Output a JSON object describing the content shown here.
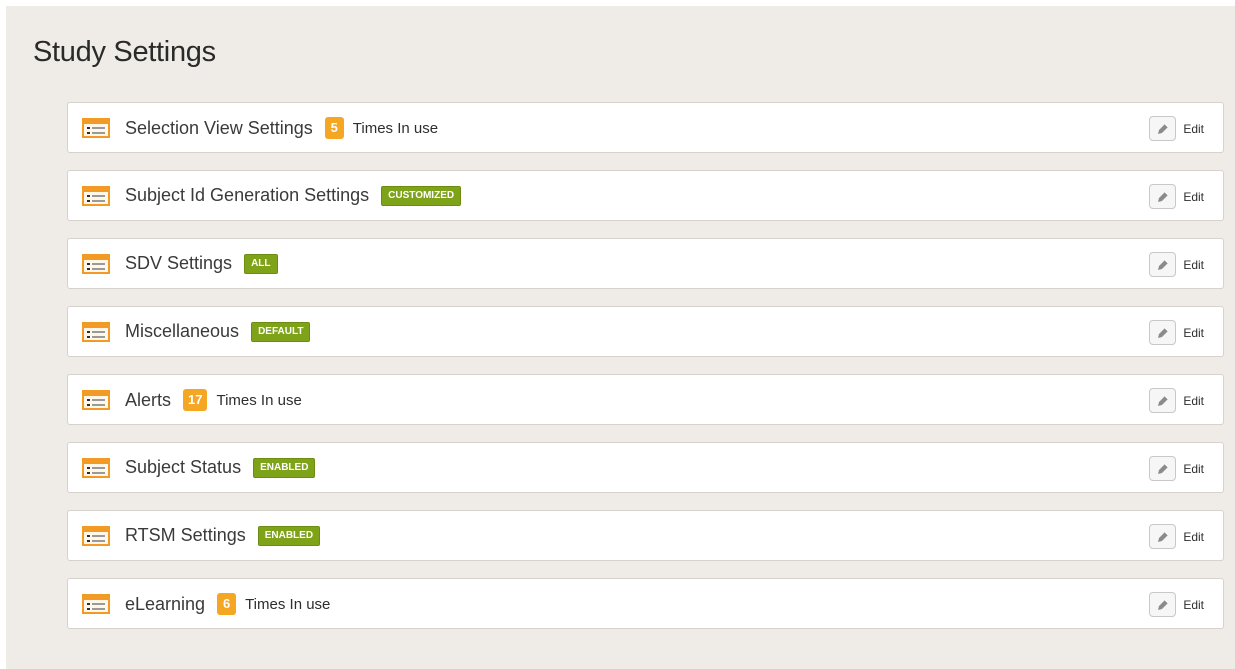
{
  "page": {
    "title": "Study Settings"
  },
  "settings": [
    {
      "label": "Selection View Settings",
      "badge_type": "count",
      "badge_text": "5",
      "usage_text": "Times In use",
      "edit_label": "Edit"
    },
    {
      "label": "Subject Id Generation Settings",
      "badge_type": "status",
      "badge_text": "CUSTOMIZED",
      "usage_text": "",
      "edit_label": "Edit"
    },
    {
      "label": "SDV Settings",
      "badge_type": "status",
      "badge_text": "ALL",
      "usage_text": "",
      "edit_label": "Edit"
    },
    {
      "label": "Miscellaneous",
      "badge_type": "status",
      "badge_text": "DEFAULT",
      "usage_text": "",
      "edit_label": "Edit"
    },
    {
      "label": "Alerts",
      "badge_type": "count",
      "badge_text": "17",
      "usage_text": "Times In use",
      "edit_label": "Edit"
    },
    {
      "label": "Subject Status",
      "badge_type": "status",
      "badge_text": "ENABLED",
      "usage_text": "",
      "edit_label": "Edit"
    },
    {
      "label": "RTSM Settings",
      "badge_type": "status",
      "badge_text": "ENABLED",
      "usage_text": "",
      "edit_label": "Edit"
    },
    {
      "label": "eLearning",
      "badge_type": "count",
      "badge_text": "6",
      "usage_text": "Times In use",
      "edit_label": "Edit"
    }
  ],
  "icons": {
    "row_icon": "settings-list-icon",
    "edit_icon": "pencil-icon"
  },
  "colors": {
    "background": "#efebe7",
    "count_badge": "#f5a623",
    "status_badge": "#7ea318",
    "settings_icon": "#f29b24"
  }
}
